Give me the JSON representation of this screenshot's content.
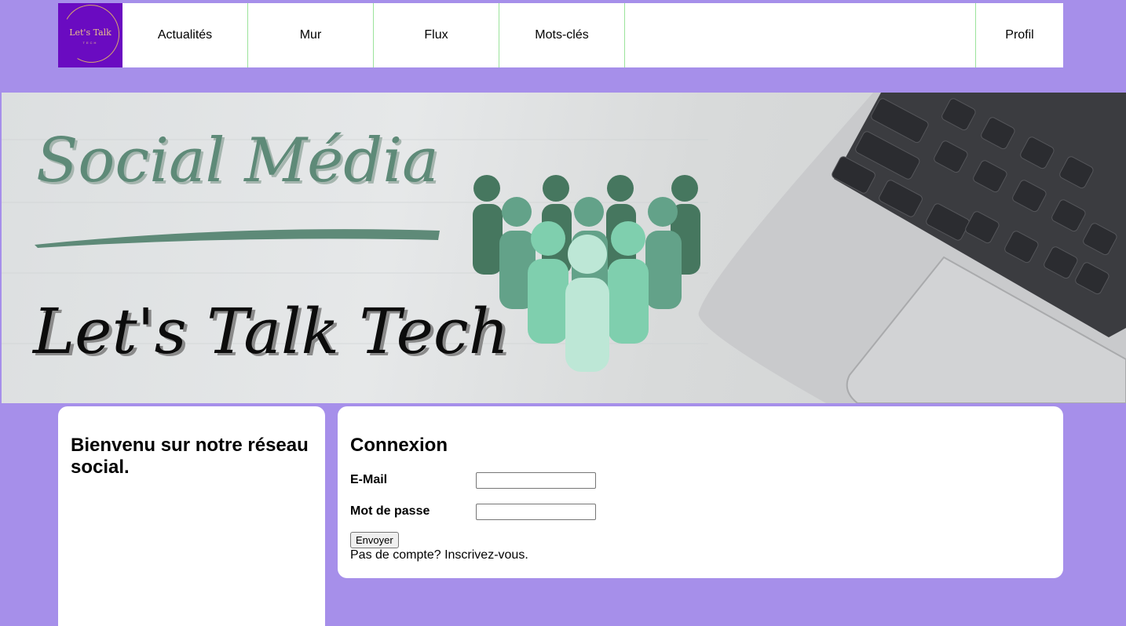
{
  "logo": {
    "text": "Let's Talk",
    "subtext": "TECH"
  },
  "nav": {
    "items": [
      "Actualités",
      "Mur",
      "Flux",
      "Mots-clés"
    ],
    "profile": "Profil"
  },
  "banner": {
    "title_top": "Social Média",
    "title_bottom": "Let's Talk Tech"
  },
  "welcome": {
    "heading": "Bienvenu sur notre réseau social."
  },
  "login": {
    "heading": "Connexion",
    "email_label": "E-Mail",
    "email_value": "",
    "password_label": "Mot de passe",
    "password_value": "",
    "submit_label": "Envoyer",
    "signup_text": "Pas de compte? Inscrivez-vous."
  },
  "colors": {
    "background": "#a68fea",
    "logo_bg": "#6a0bc1",
    "nav_divider": "#9be39b"
  }
}
